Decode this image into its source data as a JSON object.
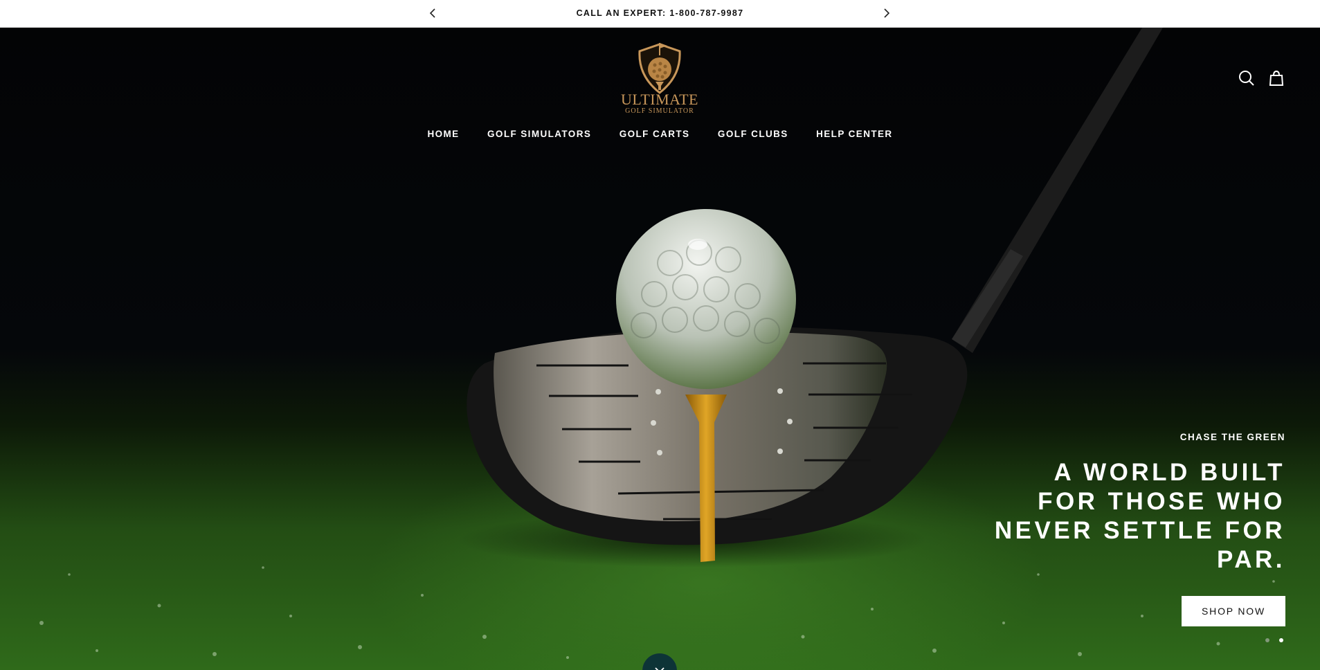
{
  "announcement": {
    "text": "CALL AN EXPERT: 1-800-787-9987",
    "prev_icon": "chevron-left-icon",
    "next_icon": "chevron-right-icon"
  },
  "header": {
    "logo": {
      "line1": "ULTIMATE",
      "line2": "GOLF SIMULATOR",
      "color": "#c8975a"
    },
    "nav": [
      {
        "label": "HOME"
      },
      {
        "label": "GOLF SIMULATORS"
      },
      {
        "label": "GOLF CARTS"
      },
      {
        "label": "GOLF CLUBS"
      },
      {
        "label": "HELP CENTER"
      }
    ],
    "icons": [
      "search-icon",
      "shopping-bag-icon"
    ]
  },
  "hero": {
    "eyebrow": "CHASE THE GREEN",
    "headline_lines": [
      "A WORLD BUILT",
      "FOR THOSE WHO",
      "NEVER SETTLE FOR",
      "PAR."
    ],
    "cta_label": "SHOP NOW",
    "slide_count": 2,
    "scroll_icon": "chevron-down-icon"
  },
  "colors": {
    "hero_dark": "#05070a",
    "turf_green": "#2f6a1a",
    "scroll_button": "#0d3437",
    "tee": "#d99a1a"
  }
}
